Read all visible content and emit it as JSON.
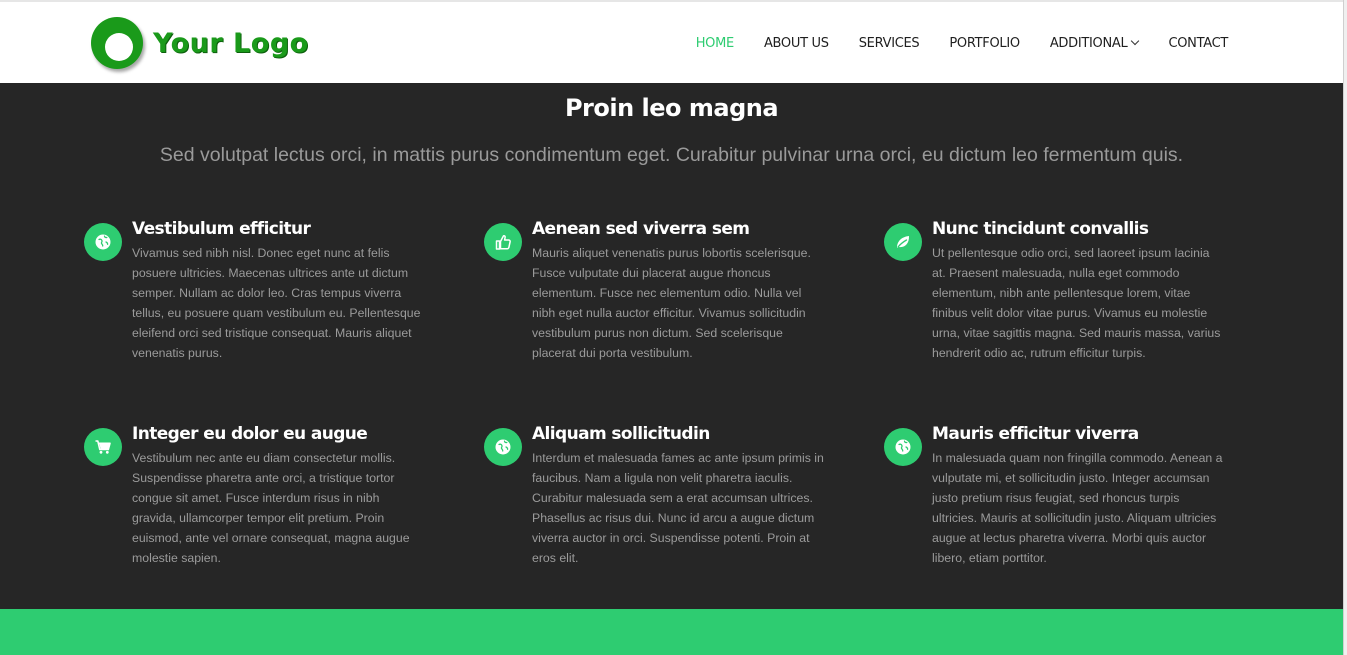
{
  "logo": {
    "text": "Your Logo"
  },
  "nav": {
    "items": [
      {
        "label": "HOME",
        "active": true
      },
      {
        "label": "ABOUT US"
      },
      {
        "label": "SERVICES"
      },
      {
        "label": "PORTFOLIO"
      },
      {
        "label": "ADDITIONAL",
        "dropdown": true
      },
      {
        "label": "CONTACT"
      }
    ]
  },
  "section": {
    "title": "Proin leo magna",
    "subtitle": "Sed volutpat lectus orci, in mattis purus condimentum eget. Curabitur pulvinar urna orci, eu dictum leo fermentum quis."
  },
  "features": [
    {
      "icon": "globe-icon",
      "title": "Vestibulum efficitur",
      "text": "Vivamus sed nibh nisl. Donec eget nunc at felis posuere ultricies. Maecenas ultrices ante ut dictum semper. Nullam ac dolor leo. Cras tempus viverra tellus, eu posuere quam vestibulum eu. Pellentesque eleifend orci sed tristique consequat. Mauris aliquet venenatis purus."
    },
    {
      "icon": "thumbs-up-icon",
      "title": "Aenean sed viverra sem",
      "text": "Mauris aliquet venenatis purus lobortis scelerisque. Fusce vulputate dui placerat augue rhoncus elementum. Fusce nec elementum odio. Nulla vel nibh eget nulla auctor efficitur. Vivamus sollicitudin vestibulum purus non dictum. Sed scelerisque placerat dui porta vestibulum."
    },
    {
      "icon": "leaf-icon",
      "title": "Nunc tincidunt convallis",
      "text": "Ut pellentesque odio orci, sed laoreet ipsum lacinia at. Praesent malesuada, nulla eget commodo elementum, nibh ante pellentesque lorem, vitae finibus velit dolor vitae purus. Vivamus eu molestie urna, vitae sagittis magna. Sed mauris massa, varius hendrerit odio ac, rutrum efficitur turpis."
    },
    {
      "icon": "cart-icon",
      "title": "Integer eu dolor eu augue",
      "text": "Vestibulum nec ante eu diam consectetur mollis. Suspendisse pharetra ante orci, a tristique tortor congue sit amet. Fusce interdum risus in nibh gravida, ullamcorper tempor elit pretium. Proin euismod, ante vel ornare consequat, magna augue molestie sapien."
    },
    {
      "icon": "globe-icon",
      "title": "Aliquam sollicitudin",
      "text": "Interdum et malesuada fames ac ante ipsum primis in faucibus. Nam a ligula non velit pharetra iaculis. Curabitur malesuada sem a erat accumsan ultrices. Phasellus ac risus dui. Nunc id arcu a augue dictum viverra auctor in orci. Suspendisse potenti. Proin at eros elit."
    },
    {
      "icon": "globe-icon",
      "title": "Mauris efficitur viverra",
      "text": "In malesuada quam non fringilla commodo. Aenean a vulputate mi, et sollicitudin justo. Integer accumsan justo pretium risus feugiat, sed rhoncus turpis ultricies. Mauris at sollicitudin justo. Aliquam ultricies augue at lectus pharetra viverra. Morbi quis auctor libero, etiam porttitor."
    }
  ],
  "colors": {
    "accent": "#2ecc71",
    "dark_bg": "#262626",
    "logo_green": "#1a9a1a"
  }
}
